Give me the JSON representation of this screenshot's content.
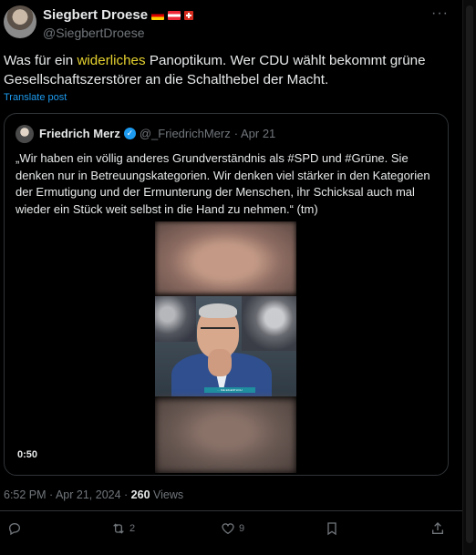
{
  "post": {
    "author_name": "Siegbert Droese",
    "author_handle": "@SiegbertDroese",
    "more_label": "···",
    "text_before": "Was für ein ",
    "text_highlight": "widerliches",
    "text_after": " Panoptikum. Wer CDU wählt bekommt grüne Gesellschaftszerstörer an die Schalthebel der Macht.",
    "translate_label": "Translate post",
    "timestamp": "6:52 PM · Apr 21, 2024 · ",
    "views_count": "260",
    "views_label": " Views"
  },
  "quote": {
    "author_name": "Friedrich Merz",
    "verified_mark": "✓",
    "author_handle": "@_FriedrichMerz",
    "date": "· Apr 21",
    "text": "„Wir haben ein völlig anderes Grundverständnis als #SPD und #Grüne. Sie denken nur in Betreuungskategorien. Wir denken viel stärker in den Kategorien der Ermutigung und der Ermunterung der Menschen, ihr Schicksal auch mal wieder ein Stück weit selbst in die Hand zu nehmen.“ (tm)",
    "video_duration": "0:50",
    "video_caption": "... NIE EIGENTLICH"
  },
  "actions": {
    "reply_count": "",
    "retweet_count": "2",
    "like_count": "9"
  },
  "colors": {
    "accent": "#1d9bf0",
    "highlight": "#e6d22f",
    "muted": "#71767b",
    "border": "#2f3336"
  }
}
